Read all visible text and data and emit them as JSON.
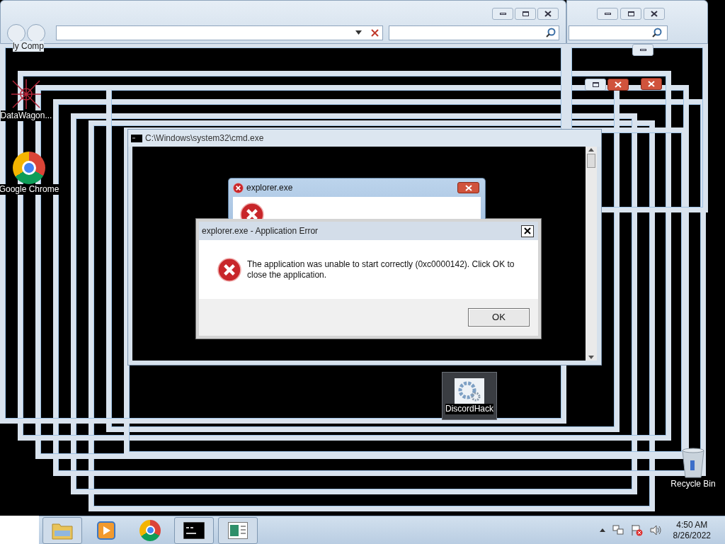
{
  "desktop_icons": [
    {
      "kind": "computer",
      "label": "ly Comp"
    },
    {
      "kind": "app",
      "label": "DataWagon..."
    },
    {
      "kind": "chrome",
      "label": "Google Chrome"
    },
    {
      "kind": "gear",
      "label": "DiscordHack"
    },
    {
      "kind": "recycle",
      "label": "Recycle Bin"
    }
  ],
  "cmd_window": {
    "title": "C:\\Windows\\system32\\cmd.exe"
  },
  "ghost_dialog": {
    "title": "explorer.exe"
  },
  "error_dialog": {
    "title": "explorer.exe - Application Error",
    "message": "The application was unable to start correctly (0xc0000142). Click OK to close the application.",
    "button": "OK"
  },
  "taskbar": {
    "apps": [
      {
        "kind": "folder"
      },
      {
        "kind": "media"
      },
      {
        "kind": "chrome"
      },
      {
        "kind": "console"
      },
      {
        "kind": "document"
      }
    ],
    "time": "4:50 AM",
    "date": "8/26/2022"
  }
}
